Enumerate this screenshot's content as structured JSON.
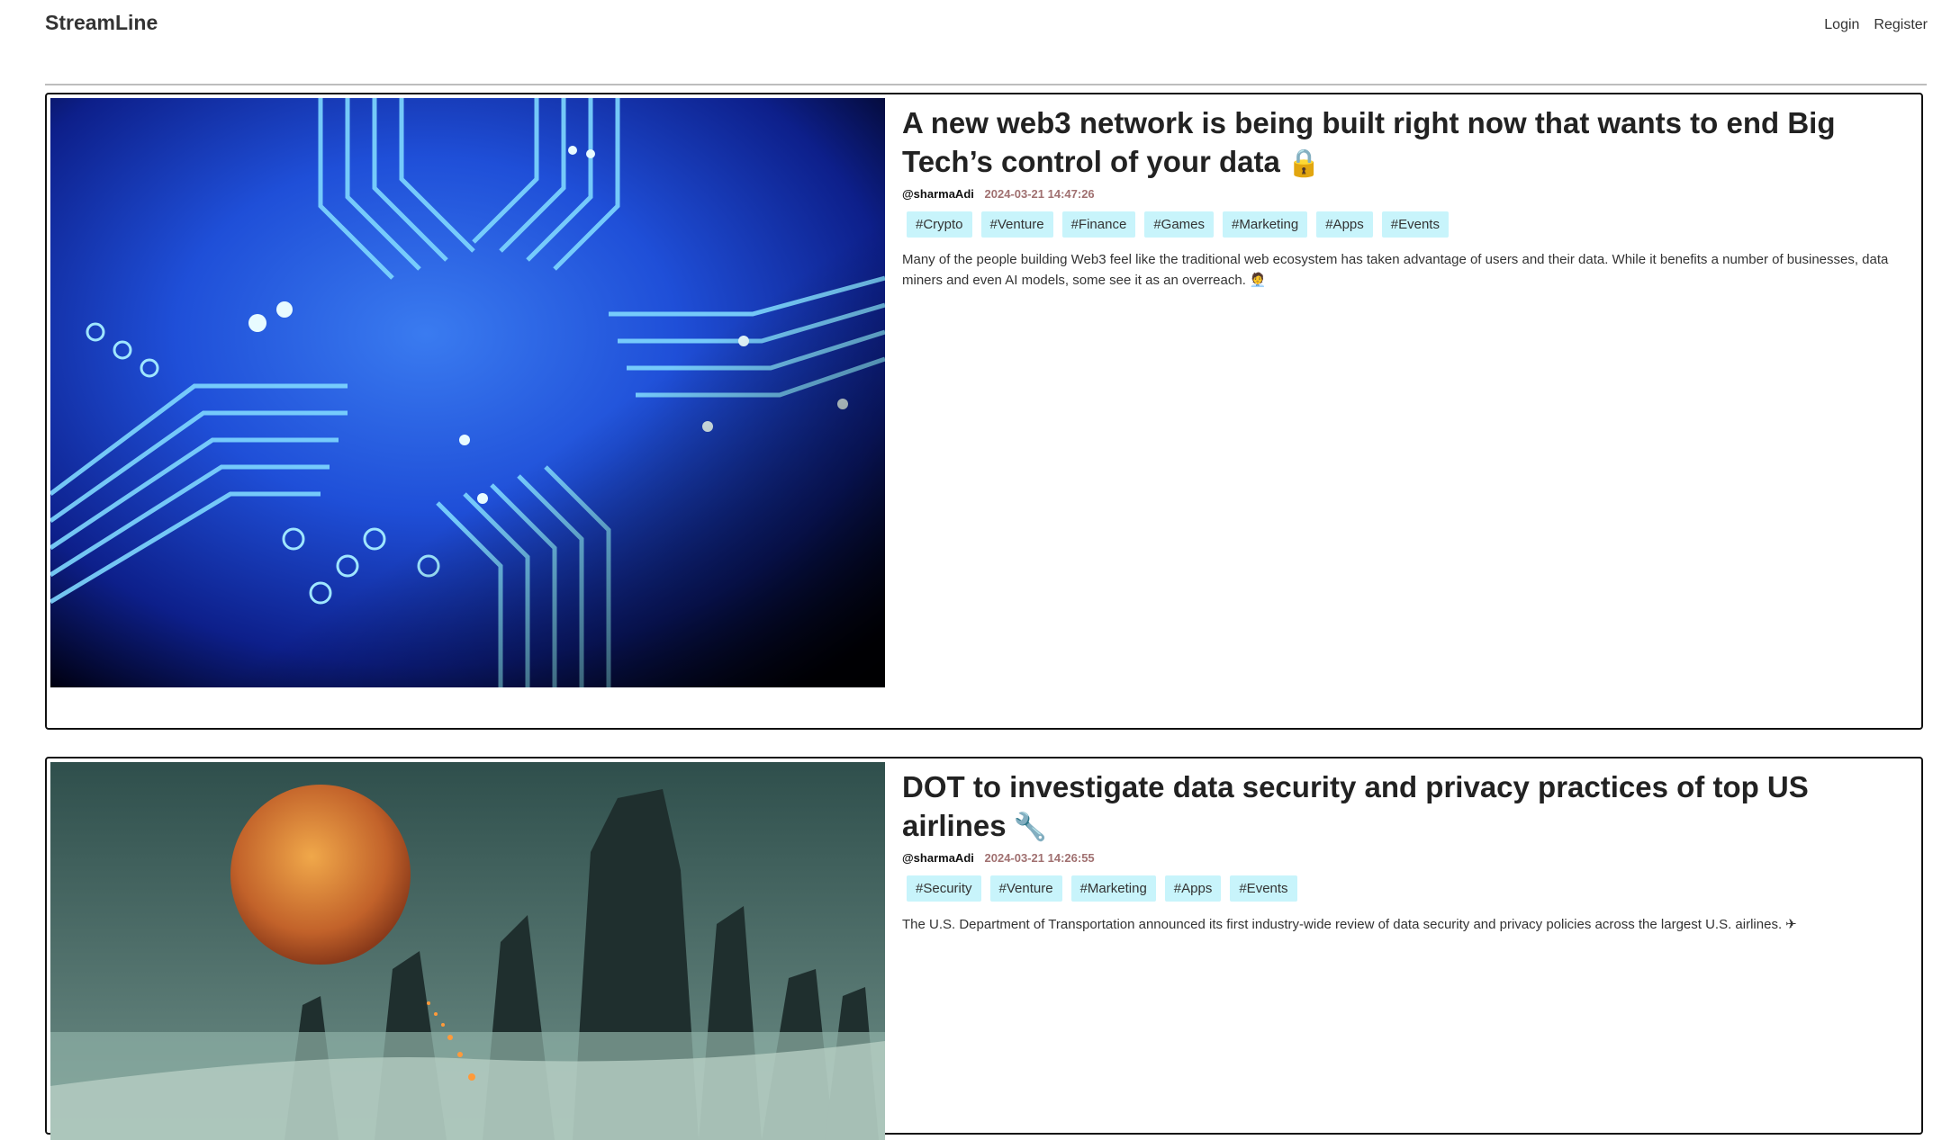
{
  "nav": {
    "brand": "StreamLine",
    "login": "Login",
    "register": "Register"
  },
  "posts": [
    {
      "title": "A new web3 network is being built right now that wants to end Big Tech’s control of your data",
      "title_emoji": "🔒",
      "title_emoji_icon": "lock-icon",
      "author": "@sharmaAdi",
      "date": "2024-03-21 14:47:26",
      "tags": [
        "#Crypto",
        "#Venture",
        "#Finance",
        "#Games",
        "#Marketing",
        "#Apps",
        "#Events"
      ],
      "description": "Many of the people building Web3 feel like the traditional web ecosystem has taken advantage of users and their data. While it benefits a number of businesses, data miners and even AI models, some see it as an overreach.",
      "description_emoji": "🧑‍💼",
      "image": "circuit-board-image"
    },
    {
      "title": "DOT to investigate data security and privacy practices of top US airlines",
      "title_emoji": "🔧",
      "title_emoji_icon": "tools-icon",
      "author": "@sharmaAdi",
      "date": "2024-03-21 14:26:55",
      "tags": [
        "#Security",
        "#Venture",
        "#Marketing",
        "#Apps",
        "#Events"
      ],
      "description": "The U.S. Department of Transportation announced its first industry-wide review of data security and privacy policies across the largest U.S. airlines.",
      "description_emoji": "✈",
      "image": "alien-landscape-image"
    }
  ],
  "colors": {
    "tag_bg": "#c8f4fb",
    "date": "#a07070",
    "card_border": "#111111"
  }
}
